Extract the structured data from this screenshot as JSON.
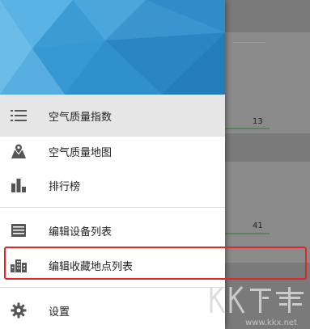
{
  "background": {
    "value_1": "13",
    "value_2": "41"
  },
  "menu": {
    "items": [
      {
        "label": "空气质量指数",
        "icon": "list-icon",
        "active": true
      },
      {
        "label": "空气质量地图",
        "icon": "map-marker-icon",
        "active": false
      },
      {
        "label": "排行榜",
        "icon": "bar-chart-icon",
        "active": false
      },
      {
        "label": "编辑设备列表",
        "icon": "device-list-icon",
        "active": false
      },
      {
        "label": "编辑收藏地点列表",
        "icon": "city-building-icon",
        "active": false
      },
      {
        "label": "设置",
        "icon": "gear-icon",
        "active": false
      }
    ]
  },
  "watermark": {
    "logo": "KK下载",
    "url": "www.kkx.net"
  },
  "colors": {
    "header_blue": "#3d9bd4",
    "highlight_red": "#e0262a",
    "icon_gray": "#555555"
  }
}
